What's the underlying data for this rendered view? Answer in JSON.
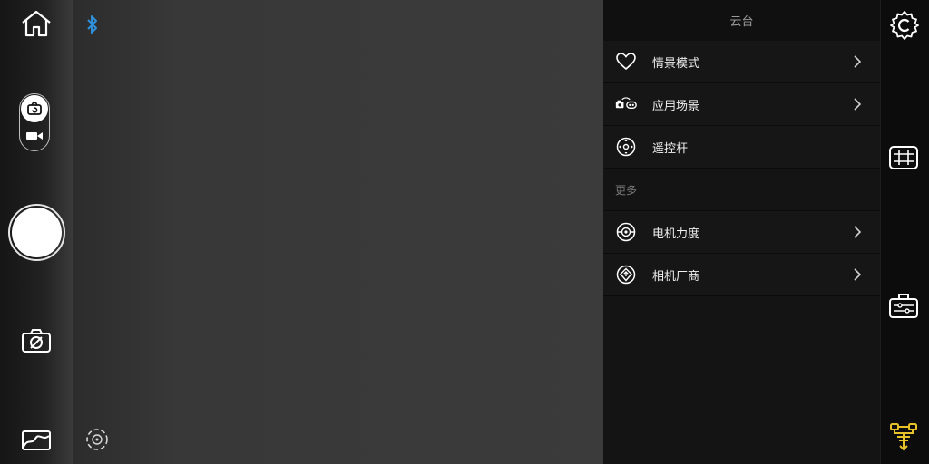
{
  "colors": {
    "accent": "#e6c229",
    "bluetooth": "#2f8fd8"
  },
  "left_rail": {
    "icons": [
      "home-icon",
      "bluetooth-icon",
      "camera-switch-icon",
      "gallery-icon",
      "focus-track-icon"
    ],
    "mode_toggle": {
      "options": [
        "photo",
        "video"
      ],
      "selected": "photo"
    }
  },
  "panel": {
    "title": "云台",
    "items": [
      {
        "label": "情景模式",
        "icon": "heart-icon",
        "chevron": true
      },
      {
        "label": "应用场景",
        "icon": "scene-icon",
        "chevron": true
      },
      {
        "label": "遥控杆",
        "icon": "joystick-icon",
        "chevron": false
      }
    ],
    "section_more": "更多",
    "more_items": [
      {
        "label": "电机力度",
        "icon": "motor-icon",
        "chevron": true
      },
      {
        "label": "相机厂商",
        "icon": "camera-brand-icon",
        "chevron": true
      }
    ]
  },
  "right_rail": {
    "icons": [
      "settings-icon",
      "grid-icon",
      "toolbox-icon",
      "gimbal-icon"
    ],
    "active": "gimbal-icon"
  }
}
